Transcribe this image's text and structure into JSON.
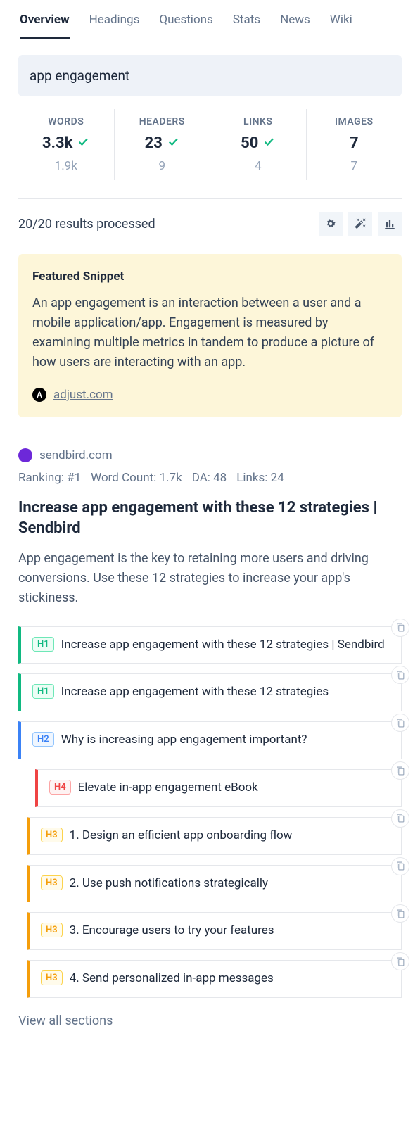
{
  "tabs": [
    "Overview",
    "Headings",
    "Questions",
    "Stats",
    "News",
    "Wiki"
  ],
  "keyword": "app engagement",
  "stats": [
    {
      "label": "WORDS",
      "value": "3.3k",
      "has_check": true,
      "sub": "1.9k"
    },
    {
      "label": "HEADERS",
      "value": "23",
      "has_check": true,
      "sub": "9"
    },
    {
      "label": "LINKS",
      "value": "50",
      "has_check": true,
      "sub": "4"
    },
    {
      "label": "IMAGES",
      "value": "7",
      "has_check": false,
      "sub": "7"
    }
  ],
  "results_processed": "20/20 results processed",
  "snippet": {
    "title": "Featured Snippet",
    "body": "An app engagement is an interaction between a user and a mobile application/app. Engagement is measured by examining multiple metrics in tandem to produce a picture of how users are interacting with an app.",
    "source": "adjust.com"
  },
  "result": {
    "domain": "sendbird.com",
    "meta": {
      "ranking": "Ranking: #1",
      "wc": "Word Count: 1.7k",
      "da": "DA: 48",
      "links": "Links: 24"
    },
    "title": "Increase app engagement with these 12 strategies | Sendbird",
    "desc": "App engagement is the key to retaining more users and driving conversions. Use these 12 strategies to increase your app's stickiness.",
    "headings": [
      {
        "level": "H1",
        "cls": "h1",
        "text": "Increase app engagement with these 12 strategies | Sendbird"
      },
      {
        "level": "H1",
        "cls": "h1",
        "text": "Increase app engagement with these 12 strategies"
      },
      {
        "level": "H2",
        "cls": "h2",
        "text": "Why is increasing app engagement important?"
      },
      {
        "level": "H4",
        "cls": "h4",
        "text": "Elevate in-app engagement eBook"
      },
      {
        "level": "H3",
        "cls": "h3",
        "text": "1. Design an efficient app onboarding flow"
      },
      {
        "level": "H3",
        "cls": "h3",
        "text": "2. Use push notifications strategically"
      },
      {
        "level": "H3",
        "cls": "h3",
        "text": "3. Encourage users to try your features"
      },
      {
        "level": "H3",
        "cls": "h3",
        "text": "4. Send personalized in-app messages"
      }
    ]
  },
  "view_all": "View all sections"
}
